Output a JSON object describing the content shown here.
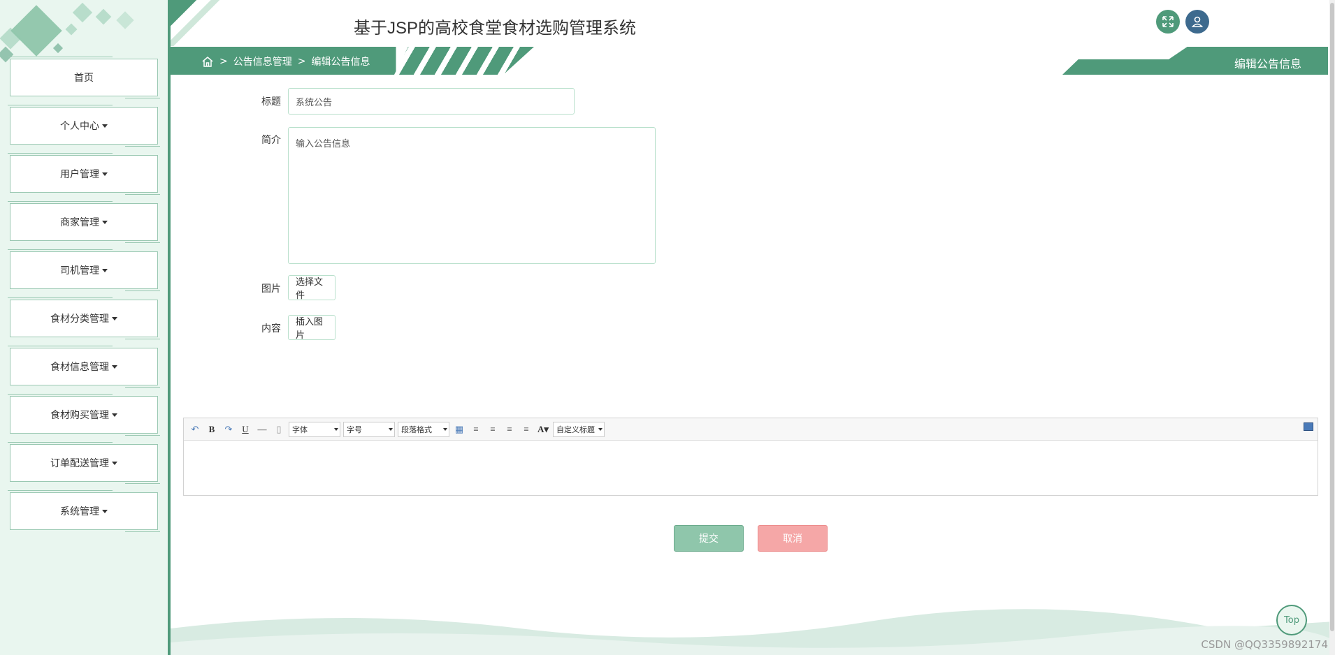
{
  "app": {
    "title": "基于JSP的高校食堂食材选购管理系统"
  },
  "header": {
    "breadcrumb": [
      ">",
      "公告信息管理",
      ">",
      "编辑公告信息"
    ],
    "page_tab": "编辑公告信息",
    "icons": [
      "fullscreen-icon",
      "user-icon"
    ]
  },
  "sidebar": {
    "items": [
      {
        "label": "首页",
        "dropdown": false
      },
      {
        "label": "个人中心",
        "dropdown": true
      },
      {
        "label": "用户管理",
        "dropdown": true
      },
      {
        "label": "商家管理",
        "dropdown": true
      },
      {
        "label": "司机管理",
        "dropdown": true
      },
      {
        "label": "食材分类管理",
        "dropdown": true
      },
      {
        "label": "食材信息管理",
        "dropdown": true
      },
      {
        "label": "食材购买管理",
        "dropdown": true
      },
      {
        "label": "订单配送管理",
        "dropdown": true
      },
      {
        "label": "系统管理",
        "dropdown": true
      }
    ]
  },
  "form": {
    "title_label": "标题",
    "title_value": "系统公告",
    "intro_label": "简介",
    "intro_value": "输入公告信息",
    "image_label": "图片",
    "image_button": "选择文件",
    "content_label": "内容",
    "content_button": "插入图片",
    "submit": "提交",
    "cancel": "取消"
  },
  "editor": {
    "font_select": "字体",
    "size_select": "字号",
    "paragraph_select": "段落格式",
    "custom_select": "自定义标题",
    "bold": "B",
    "underline": "U",
    "font_color": "A"
  },
  "footer": {
    "top_button": "Top",
    "watermark": "CSDN @QQ3359892174"
  },
  "colors": {
    "accent": "#4f9a7a",
    "sidebar_bg": "#e9f6ef",
    "submit": "#8fc6ab",
    "cancel": "#f5a7a7"
  }
}
